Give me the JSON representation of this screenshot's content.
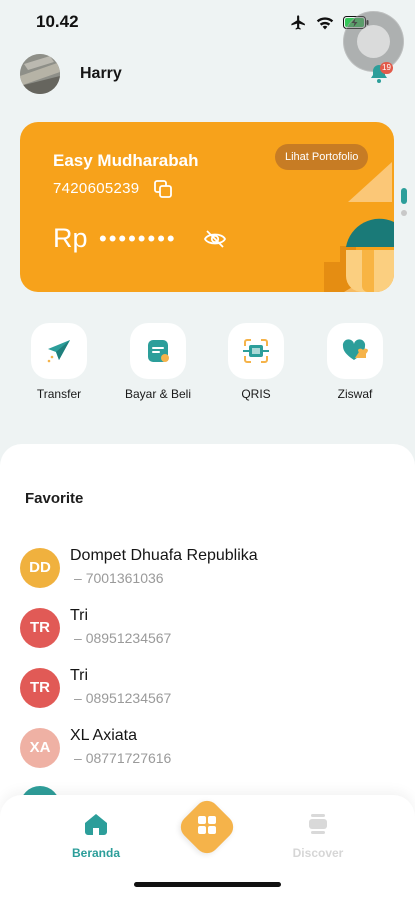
{
  "status_bar": {
    "time": "10.42",
    "icons": [
      "airplane-icon",
      "wifi-icon",
      "battery-charging-icon"
    ]
  },
  "header": {
    "user_name": "Harry",
    "notification_count": "19"
  },
  "account_card": {
    "title": "Easy Mudharabah",
    "account_number": "7420605239",
    "portfolio_button": "Lihat Portofolio",
    "balance_currency": "Rp",
    "balance_masked": "••••••••",
    "color": "#f7a21b"
  },
  "actions": [
    {
      "label": "Transfer",
      "icon": "paper-plane-icon"
    },
    {
      "label": "Bayar & Beli",
      "icon": "bill-icon"
    },
    {
      "label": "QRIS",
      "icon": "qr-scan-icon"
    },
    {
      "label": "Ziswaf",
      "icon": "heart-hand-icon"
    }
  ],
  "favorites": {
    "title": "Favorite",
    "contacts": [
      {
        "initials": "DD",
        "name": "Dompet Dhuafa Republika",
        "number": "7001361036",
        "color": "#f0b13e"
      },
      {
        "initials": "TR",
        "name": "Tri",
        "number": "08951234567",
        "color": "#e15a56"
      },
      {
        "initials": "TR",
        "name": "Tri",
        "number": "08951234567",
        "color": "#e15a56"
      },
      {
        "initials": "XA",
        "name": "XL Axiata",
        "number": "08771727616",
        "color": "#efb1a4"
      }
    ]
  },
  "bottom_nav": {
    "home": "Beranda",
    "discover": "Discover",
    "accent": "#2c9e9a"
  }
}
